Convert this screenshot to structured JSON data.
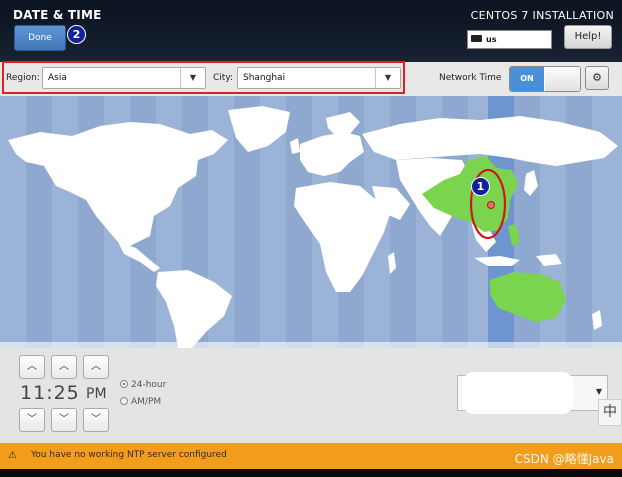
{
  "header": {
    "title": "DATE & TIME",
    "done_label": "Done",
    "badge_done": "2",
    "installation": "CENTOS 7 INSTALLATION",
    "keyboard_layout": "us",
    "help_label": "Help!"
  },
  "toolbar": {
    "region_label": "Region:",
    "region_value": "Asia",
    "city_label": "City:",
    "city_value": "Shanghai",
    "network_time_label": "Network Time",
    "network_time_state": "ON"
  },
  "map": {
    "badge_location": "1",
    "highlight_color": "#7bd44e",
    "ocean_color": "#8fa8cf",
    "annotation_color": "#e02020"
  },
  "time": {
    "hours": "11",
    "separator": ":",
    "minutes": "25",
    "ampm": "PM",
    "format_24": "24-hour",
    "format_ampm": "AM/PM",
    "selected_format": "24-hour"
  },
  "ime_indicator": "中",
  "warning": {
    "message": "You have no working NTP server configured",
    "color": "#f29d1c"
  },
  "watermark": "CSDN @略懂Java"
}
